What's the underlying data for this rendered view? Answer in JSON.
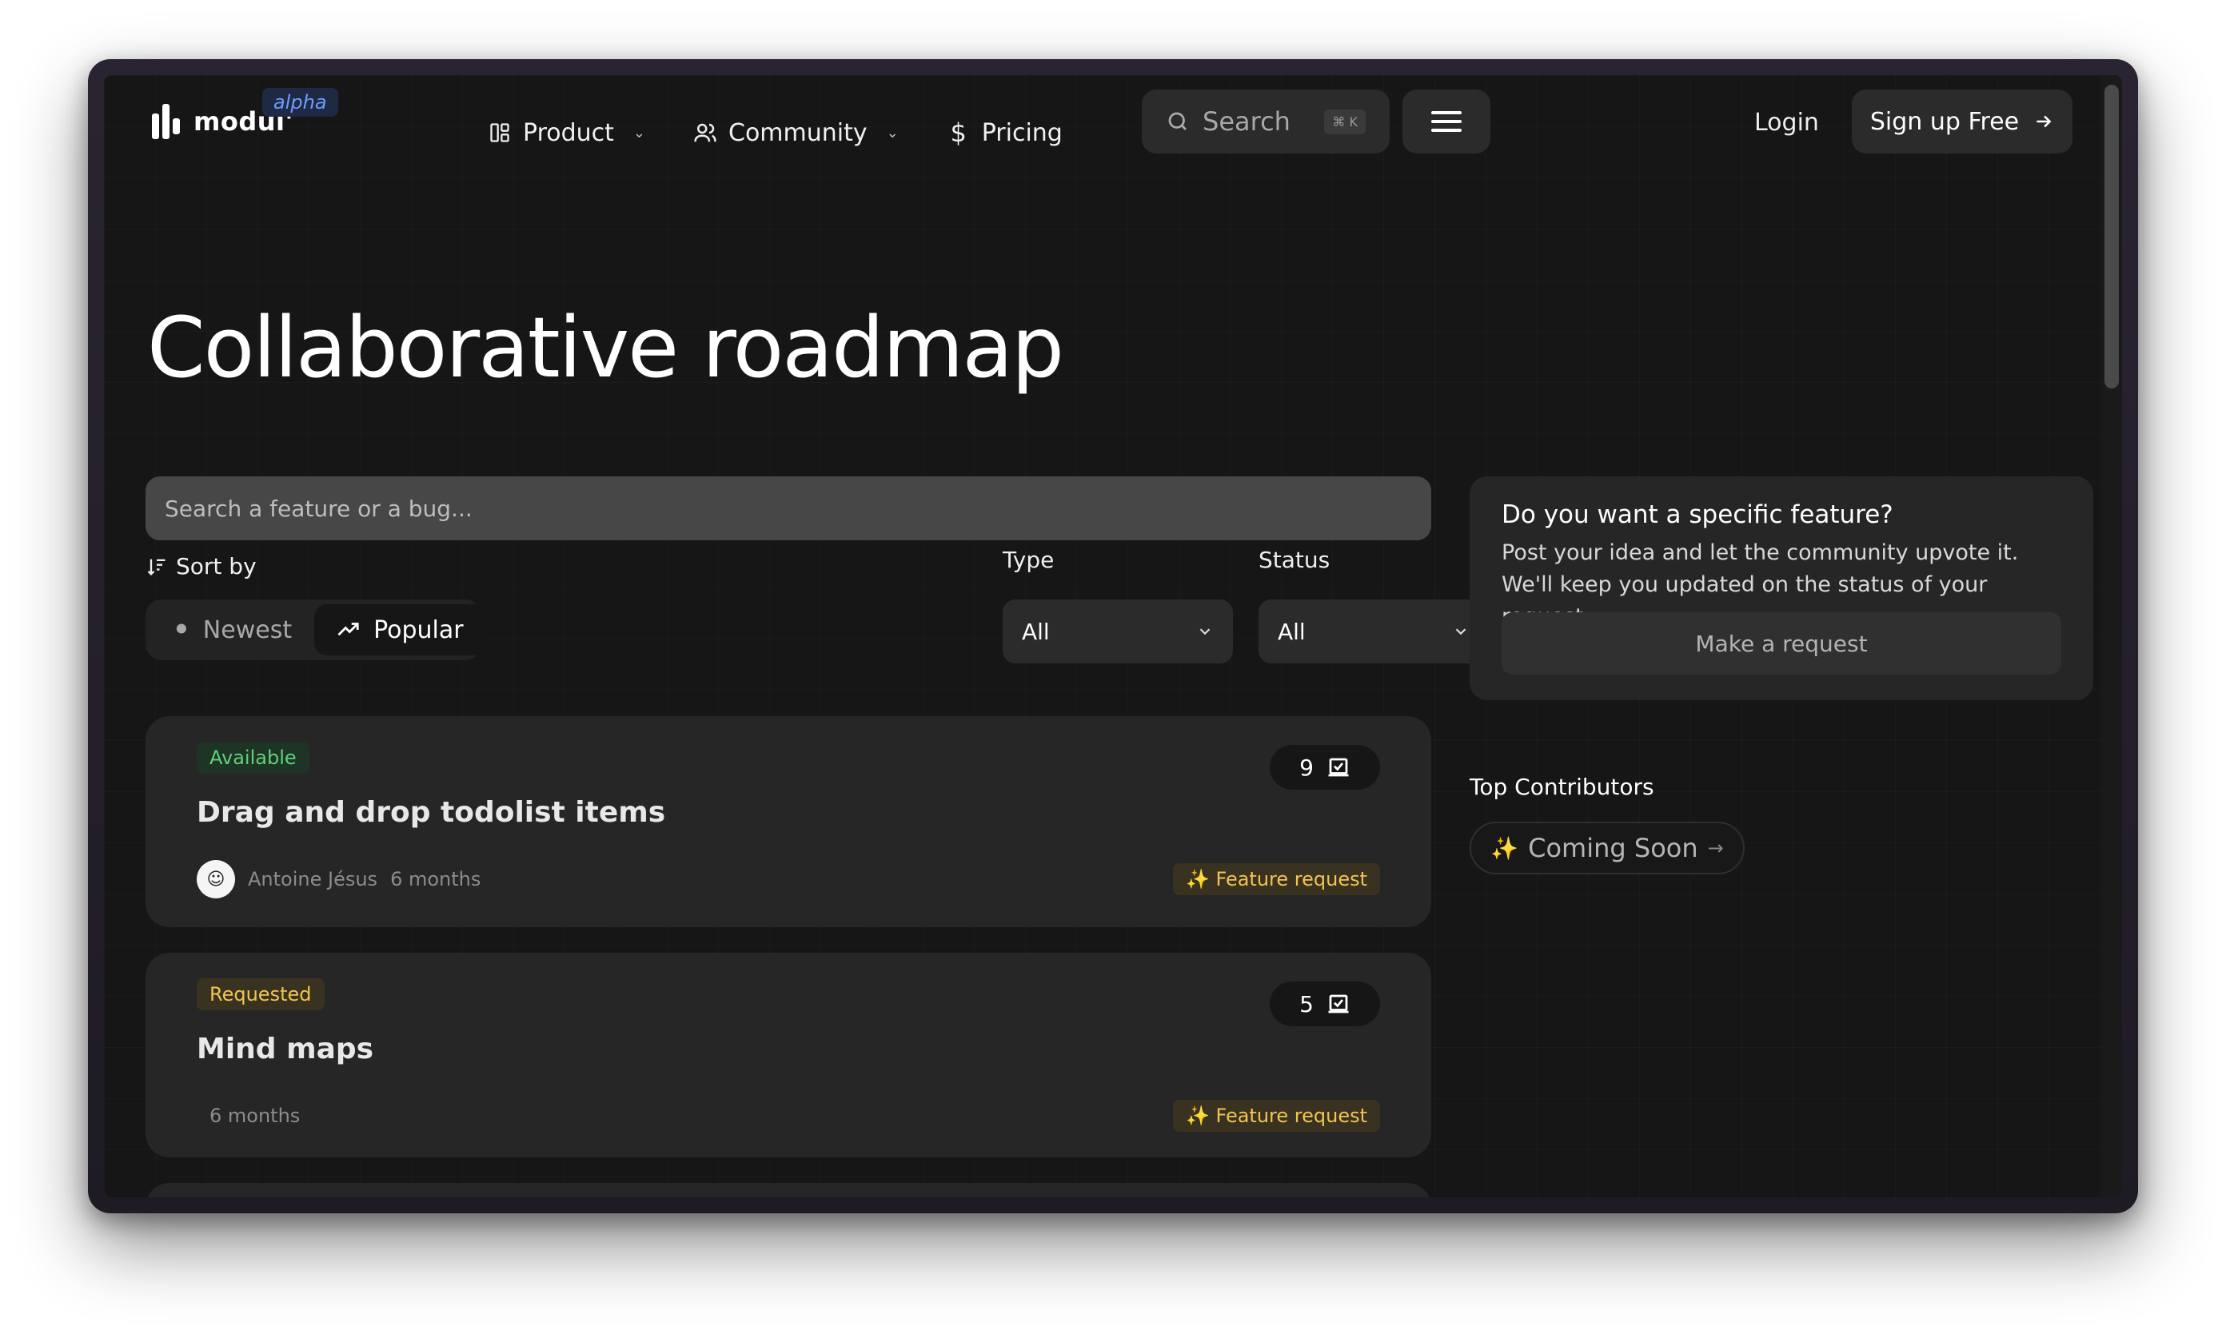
{
  "header": {
    "logo_text": "modul'",
    "badge": "alpha",
    "nav": [
      {
        "label": "Product",
        "icon": "layout-icon"
      },
      {
        "label": "Community",
        "icon": "users-icon"
      },
      {
        "label": "Pricing",
        "icon": "dollar-icon"
      }
    ],
    "search_label": "Search",
    "search_shortcut": "⌘ K",
    "login": "Login",
    "signup": "Sign up Free"
  },
  "page": {
    "title": "Collaborative roadmap"
  },
  "filters": {
    "search_placeholder": "Search a feature or a bug...",
    "sort_label": "Sort by",
    "sort_options": [
      {
        "label": "Newest",
        "active": false
      },
      {
        "label": "Popular",
        "active": true
      }
    ],
    "type_label": "Type",
    "type_value": "All",
    "status_label": "Status",
    "status_value": "All"
  },
  "cards": [
    {
      "status": "Available",
      "status_color": "#5fd17a",
      "status_bg": "#1e3424",
      "votes": "9",
      "title": "Drag and drop todolist items",
      "author": "Antoine Jésus",
      "time": "6 months",
      "type": "✨ Feature request"
    },
    {
      "status": "Requested",
      "status_color": "#f1c451",
      "status_bg": "#3a3220",
      "votes": "5",
      "title": "Mind maps",
      "author": "",
      "time": "6 months",
      "type": "✨ Feature request"
    }
  ],
  "sidebar": {
    "feature_title": "Do you want a specific feature?",
    "feature_text": "Post your idea and let the community upvote it. We'll keep you updated on the status of your request.",
    "make_request": "Make a request",
    "top_contributors": "Top Contributors",
    "coming_soon": "Coming Soon"
  },
  "colors": {
    "background": "#161616",
    "card": "#262626",
    "accent_blue": "#6d9cff"
  }
}
